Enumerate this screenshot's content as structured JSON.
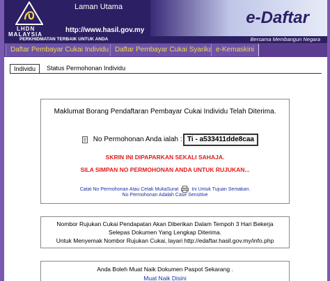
{
  "header": {
    "logo_line1": "LHDN",
    "logo_line2": "MALAYSIA",
    "home_link": "Laman Utama",
    "url": "http://www.hasil.gov.my",
    "brand_title": "e-Daftar",
    "slogan_left": "PERKHIDMATAN TERBAIK UNTUK ANDA",
    "slogan_right": "Bersama Membangun Negara"
  },
  "nav": {
    "items": [
      {
        "label": "Daftar Pembayar Cukai Individu"
      },
      {
        "label": "Daftar Pembayar Cukai Syarikat"
      },
      {
        "label": "e-Kemaskini"
      }
    ]
  },
  "tabs": [
    {
      "label": "Individu",
      "active": true
    },
    {
      "label": "Status Permohonan Individu",
      "active": false
    }
  ],
  "confirmation": {
    "title": "Maklumat Borang Pendaftaran Pembayar Cukai Individu Telah Diterima.",
    "application_label": "No Permohonan Anda ialah :",
    "application_number": "Ti - a533411dde8caa",
    "warning_1": "SKRIN INI DIPAPARKAN SEKALI SAHAJA.",
    "warning_2": "SILA SIMPAN NO PERMOHONAN ANDA UNTUK RUJUKAN...",
    "print_before": "Catat No Permohonan Atau Cetak MukaSurat",
    "print_after": "Ini Untuk Tujuan Semakan.",
    "case_note": "No Permohonan Adalah Case Sensitive"
  },
  "reference": {
    "line1": "Nombor Rujukan Cukai Pendapatan Akan Diberikan Dalam Tempoh 3 Hari Bekerja",
    "line2": "Selepas Dokumen Yang Lengkap Diterima.",
    "line3": "Untuk Menyemak Nombor Rujukan Cukai, layari http://edaftar.hasil.gov.my/info.php"
  },
  "upload": {
    "text": "Anda Boleh Muat Naik Dokumen Paspot Sekarang .",
    "link": "Muat Naik Disini"
  },
  "colors": {
    "header_bg": "#2d1f63",
    "nav_text": "#f4d84a",
    "warning": "#e01b1b",
    "link": "#1a2fa0",
    "page_bg": "#7a5ab0"
  }
}
